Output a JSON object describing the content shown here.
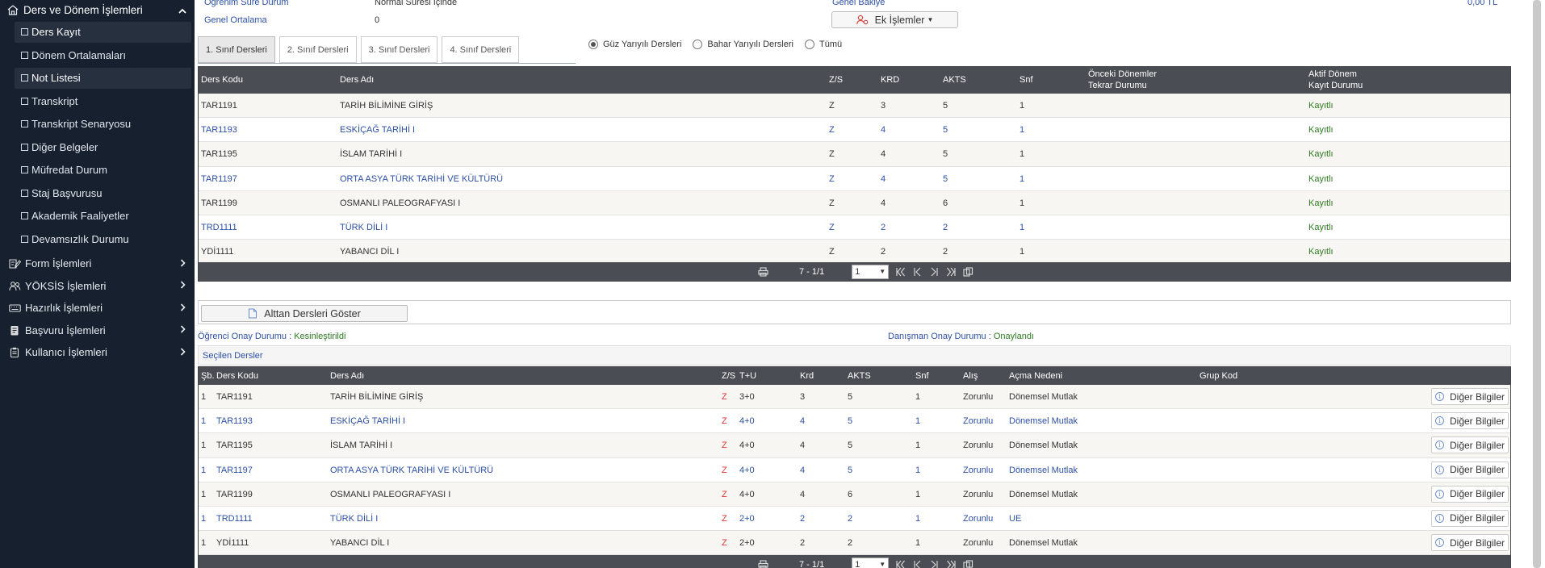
{
  "sidebar": {
    "header": {
      "label": "Ders ve Dönem İşlemleri"
    },
    "items": [
      {
        "label": "Ders Kayıt"
      },
      {
        "label": "Dönem Ortalamaları"
      },
      {
        "label": "Not Listesi"
      },
      {
        "label": "Transkript"
      },
      {
        "label": "Transkript Senaryosu"
      },
      {
        "label": "Diğer Belgeler"
      },
      {
        "label": "Müfredat Durum"
      },
      {
        "label": "Staj Başvurusu"
      },
      {
        "label": "Akademik Faaliyetler"
      },
      {
        "label": "Devamsızlık Durumu"
      }
    ],
    "groups": [
      {
        "label": "Form İşlemleri"
      },
      {
        "label": "YÖKSİS İşlemleri"
      },
      {
        "label": "Hazırlık İşlemleri"
      },
      {
        "label": "Başvuru İşlemleri"
      },
      {
        "label": "Kullanıcı İşlemleri"
      }
    ]
  },
  "info": {
    "status_label": "Öğrenim Süre Durum",
    "status_value": "Normal Süresi İçinde",
    "gpa_label": "Genel Ortalama",
    "gpa_value": "0",
    "balance_label": "Genel Bakiye",
    "balance_value": "0,00 TL",
    "extra_button": "Ek İşlemler"
  },
  "tabs": [
    {
      "label": "1. Sınıf Dersleri"
    },
    {
      "label": "2. Sınıf Dersleri"
    },
    {
      "label": "3. Sınıf Dersleri"
    },
    {
      "label": "4. Sınıf Dersleri"
    }
  ],
  "radios": [
    {
      "label": "Güz Yarıyılı Dersleri",
      "checked": true
    },
    {
      "label": "Bahar Yarıyılı Dersleri",
      "checked": false
    },
    {
      "label": "Tümü",
      "checked": false
    }
  ],
  "course_table": {
    "headers": {
      "code": "Ders Kodu",
      "name": "Ders Adı",
      "zs": "Z/S",
      "krd": "KRD",
      "akts": "AKTS",
      "snf": "Snf",
      "prev_line1": "Önceki Dönemler",
      "prev_line2": "Tekrar Durumu",
      "active_line1": "Aktif Dönem",
      "active_line2": "Kayıt Durumu"
    },
    "rows": [
      {
        "code": "TAR1191",
        "name": "TARİH BİLİMİNE GİRİŞ",
        "zs": "Z",
        "krd": "3",
        "akts": "5",
        "snf": "1",
        "prev": "",
        "status": "Kayıtlı"
      },
      {
        "code": "TAR1193",
        "name": "ESKİÇAĞ TARİHİ I",
        "zs": "Z",
        "krd": "4",
        "akts": "5",
        "snf": "1",
        "prev": "",
        "status": "Kayıtlı"
      },
      {
        "code": "TAR1195",
        "name": "İSLAM TARİHİ I",
        "zs": "Z",
        "krd": "4",
        "akts": "5",
        "snf": "1",
        "prev": "",
        "status": "Kayıtlı"
      },
      {
        "code": "TAR1197",
        "name": "ORTA ASYA TÜRK TARİHİ VE KÜLTÜRÜ",
        "zs": "Z",
        "krd": "4",
        "akts": "5",
        "snf": "1",
        "prev": "",
        "status": "Kayıtlı"
      },
      {
        "code": "TAR1199",
        "name": "OSMANLI PALEOGRAFYASI I",
        "zs": "Z",
        "krd": "4",
        "akts": "6",
        "snf": "1",
        "prev": "",
        "status": "Kayıtlı"
      },
      {
        "code": "TRD1111",
        "name": "TÜRK DİLİ I",
        "zs": "Z",
        "krd": "2",
        "akts": "2",
        "snf": "1",
        "prev": "",
        "status": "Kayıtlı"
      },
      {
        "code": "YDİ1111",
        "name": "YABANCI DİL I",
        "zs": "Z",
        "krd": "2",
        "akts": "2",
        "snf": "1",
        "prev": "",
        "status": "Kayıtlı"
      }
    ],
    "pager": {
      "summary": "7 - 1/1",
      "page": "1"
    }
  },
  "alt_button": "Alttan Dersleri Göster",
  "approval": {
    "student_label": "Öğrenci Onay Durumu :",
    "student_value": "Kesinleştirildi",
    "advisor_label": "Danışman Onay Durumu :",
    "advisor_value": "Onaylandı"
  },
  "selected": {
    "title": "Seçilen Dersler",
    "headers": {
      "sb": "Şb.",
      "code": "Ders Kodu",
      "name": "Ders Adı",
      "zs": "Z/S",
      "tu": "T+U",
      "krd": "Krd",
      "akts": "AKTS",
      "snf": "Snf",
      "alis": "Alış",
      "reason": "Açma Nedeni",
      "group": "Grup Kod"
    },
    "other_label": "Diğer Bilgiler",
    "rows": [
      {
        "sb": "1",
        "code": "TAR1191",
        "name": "TARİH BİLİMİNE GİRİŞ",
        "zs": "Z",
        "tu": "3+0",
        "krd": "3",
        "akts": "5",
        "snf": "1",
        "alis": "Zorunlu",
        "reason": "Dönemsel Mutlak",
        "group": ""
      },
      {
        "sb": "1",
        "code": "TAR1193",
        "name": "ESKİÇAĞ TARİHİ I",
        "zs": "Z",
        "tu": "4+0",
        "krd": "4",
        "akts": "5",
        "snf": "1",
        "alis": "Zorunlu",
        "reason": "Dönemsel Mutlak",
        "group": ""
      },
      {
        "sb": "1",
        "code": "TAR1195",
        "name": "İSLAM TARİHİ I",
        "zs": "Z",
        "tu": "4+0",
        "krd": "4",
        "akts": "5",
        "snf": "1",
        "alis": "Zorunlu",
        "reason": "Dönemsel Mutlak",
        "group": ""
      },
      {
        "sb": "1",
        "code": "TAR1197",
        "name": "ORTA ASYA TÜRK TARİHİ VE KÜLTÜRÜ",
        "zs": "Z",
        "tu": "4+0",
        "krd": "4",
        "akts": "5",
        "snf": "1",
        "alis": "Zorunlu",
        "reason": "Dönemsel Mutlak",
        "group": ""
      },
      {
        "sb": "1",
        "code": "TAR1199",
        "name": "OSMANLI PALEOGRAFYASI I",
        "zs": "Z",
        "tu": "4+0",
        "krd": "4",
        "akts": "6",
        "snf": "1",
        "alis": "Zorunlu",
        "reason": "Dönemsel Mutlak",
        "group": ""
      },
      {
        "sb": "1",
        "code": "TRD1111",
        "name": "TÜRK DİLİ I",
        "zs": "Z",
        "tu": "2+0",
        "krd": "2",
        "akts": "2",
        "snf": "1",
        "alis": "Zorunlu",
        "reason": "UE",
        "group": ""
      },
      {
        "sb": "1",
        "code": "YDİ1111",
        "name": "YABANCI DİL I",
        "zs": "Z",
        "tu": "2+0",
        "krd": "2",
        "akts": "2",
        "snf": "1",
        "alis": "Zorunlu",
        "reason": "Dönemsel Mutlak",
        "group": ""
      }
    ],
    "pager": {
      "summary": "7 - 1/1",
      "page": "1"
    }
  },
  "colors": {
    "sidebar_bg": "#16202e",
    "header_bg": "#4a4d53",
    "link_blue": "#2c4fa5",
    "status_green": "#2d7a1f",
    "required_red": "#d33333"
  },
  "icons": {
    "sidebar_header": "school-icon",
    "groups": [
      "form-edit-icon",
      "users-icon",
      "keyboard-icon",
      "document-icon",
      "clipboard-icon"
    ],
    "pager": [
      "print-icon",
      "first-page-icon",
      "prev-page-icon",
      "next-page-icon",
      "last-page-icon",
      "copy-icon"
    ]
  }
}
